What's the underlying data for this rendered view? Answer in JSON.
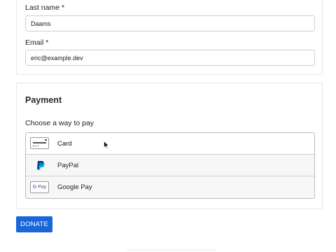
{
  "contact": {
    "last_name_label": "Last name *",
    "last_name_value": "Daams",
    "email_label": "Email *",
    "email_value": "eric@example.dev"
  },
  "payment": {
    "title": "Payment",
    "prompt": "Choose a way to pay",
    "options": [
      {
        "label": "Card",
        "icon": "credit-card-icon",
        "selected": true
      },
      {
        "label": "PayPal",
        "icon": "paypal-icon",
        "selected": false
      },
      {
        "label": "Google Pay",
        "icon": "google-pay-icon",
        "selected": false,
        "icon_text": "Pay"
      }
    ]
  },
  "actions": {
    "donate_label": "DONATE"
  },
  "colors": {
    "primary": "#1a66d9",
    "paypal_dark": "#003087",
    "paypal_light": "#009cde"
  }
}
